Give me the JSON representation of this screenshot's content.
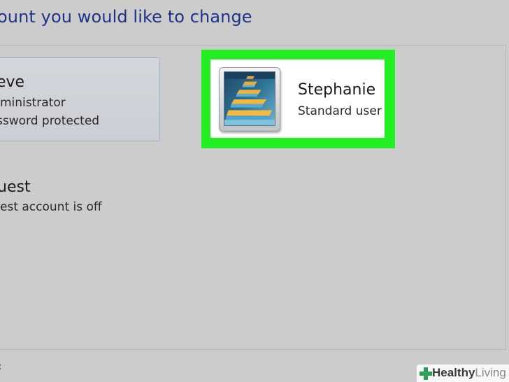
{
  "heading": "ount you would like to change",
  "accounts": [
    {
      "name": "eve",
      "lines": [
        "ministrator",
        "ssword protected"
      ]
    },
    {
      "name": "Stephanie",
      "lines": [
        "Standard user"
      ],
      "selected": true
    },
    {
      "name": "uest",
      "lines": [
        "est account is off"
      ]
    }
  ],
  "corner_mark": ":",
  "watermark": {
    "part1": "Healthy",
    "part2": "Living"
  },
  "colors": {
    "highlight": "#22ee22",
    "heading": "#1e3287",
    "background": "#cccccc"
  }
}
